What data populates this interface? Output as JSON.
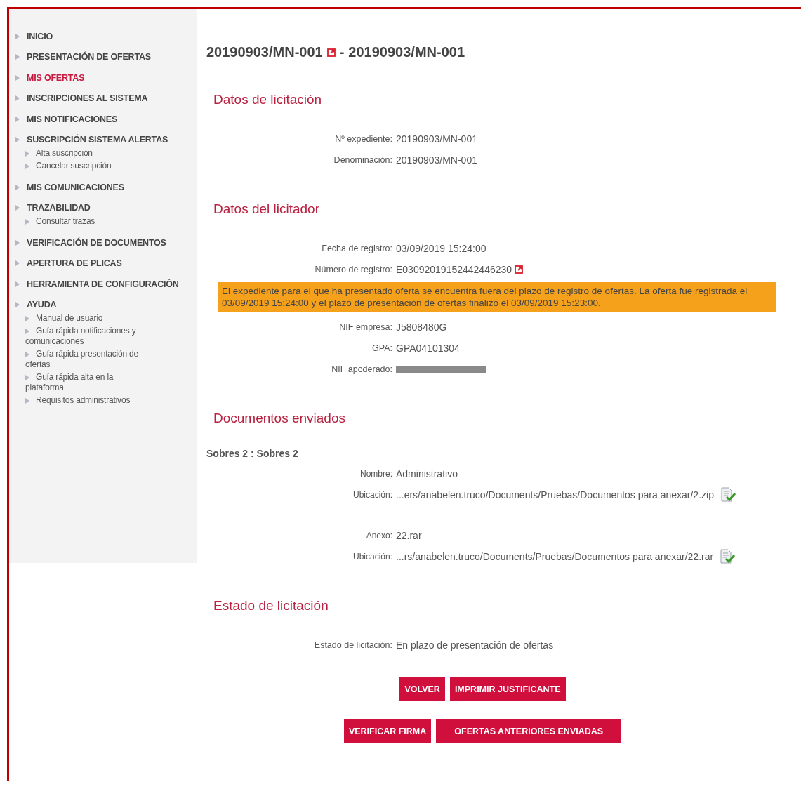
{
  "sidebar": {
    "items": [
      {
        "label": "INICIO",
        "selected": false
      },
      {
        "label": "PRESENTACIÓN DE OFERTAS",
        "selected": false
      },
      {
        "label": "MIS OFERTAS",
        "selected": true
      },
      {
        "label": "INSCRIPCIONES AL SISTEMA",
        "selected": false
      },
      {
        "label": "MIS NOTIFICACIONES",
        "selected": false
      },
      {
        "label": "SUSCRIPCIÓN SISTEMA ALERTAS",
        "selected": false,
        "children": [
          {
            "label": "Alta suscripción"
          },
          {
            "label": "Cancelar suscripción"
          }
        ]
      },
      {
        "label": "MIS COMUNICACIONES",
        "selected": false
      },
      {
        "label": "TRAZABILIDAD",
        "selected": false,
        "children": [
          {
            "label": "Consultar trazas"
          }
        ]
      },
      {
        "label": "VERIFICACIÓN DE DOCUMENTOS",
        "selected": false
      },
      {
        "label": "APERTURA DE PLICAS",
        "selected": false
      },
      {
        "label": "HERRAMIENTA DE CONFIGURACIÓN",
        "selected": false
      },
      {
        "label": "AYUDA",
        "selected": false,
        "children": [
          {
            "label": "Manual de usuario"
          },
          {
            "label": "Guía rápida notificaciones y comunicaciones"
          },
          {
            "label": "Guía rápida presentación de ofertas"
          },
          {
            "label": "Guía rápida alta en la plataforma"
          },
          {
            "label": "Requisitos administrativos"
          }
        ]
      }
    ]
  },
  "title": {
    "code": "20190903/MN-001",
    "separator": "-",
    "name": "20190903/MN-001"
  },
  "sections": [
    {
      "title": "Datos de licitación",
      "items": [
        {
          "kind": "field",
          "label": "Nº expediente:",
          "value": "20190903/MN-001"
        },
        {
          "kind": "field",
          "label": "Denominación:",
          "value": "20190903/MN-001"
        }
      ]
    },
    {
      "title": "Datos del licitador",
      "items": [
        {
          "kind": "field",
          "label": "Fecha de registro:",
          "value": "03/09/2019 15:24:00"
        },
        {
          "kind": "link_field",
          "label": "Número de registro:",
          "value": "E03092019152442446230"
        },
        {
          "kind": "notice",
          "text": "El expediente para el que ha presentado oferta se encuentra fuera del plazo de registro de ofertas. La oferta fue registrada el 03/09/2019 15:24:00 y el plazo de presentación de ofertas finalizo el 03/09/2019 15:23:00."
        },
        {
          "kind": "field",
          "label": "NIF empresa:",
          "value": "J5808480G"
        },
        {
          "kind": "field",
          "label": "GPA:",
          "value": "GPA04101304"
        },
        {
          "kind": "redacted",
          "label": "NIF apoderado:"
        }
      ]
    },
    {
      "title": "Documentos enviados",
      "items": [
        {
          "kind": "envelope",
          "text": "Sobres 2 : Sobres 2"
        },
        {
          "kind": "document",
          "label": "Nombre:",
          "value": "Administrativo",
          "location_label": "Ubicación:",
          "location": "...ers/anabelen.truco/Documents/Pruebas/Documentos para anexar/2.zip"
        },
        {
          "kind": "document",
          "label": "Anexo:",
          "value": "22.rar",
          "location_label": "Ubicación:",
          "location": "...rs/anabelen.truco/Documents/Pruebas/Documentos para anexar/22.rar"
        }
      ]
    },
    {
      "title": "Estado de licitación",
      "items": [
        {
          "kind": "field",
          "label": "Estado de licitación:",
          "value": "En plazo de presentación de ofertas"
        }
      ]
    }
  ],
  "button_rows": [
    [
      "VOLVER",
      "IMPRIMIR JUSTIFICANTE"
    ],
    [
      "VERIFICAR FIRMA",
      "OFERTAS ANTERIORES ENVIADAS"
    ]
  ]
}
